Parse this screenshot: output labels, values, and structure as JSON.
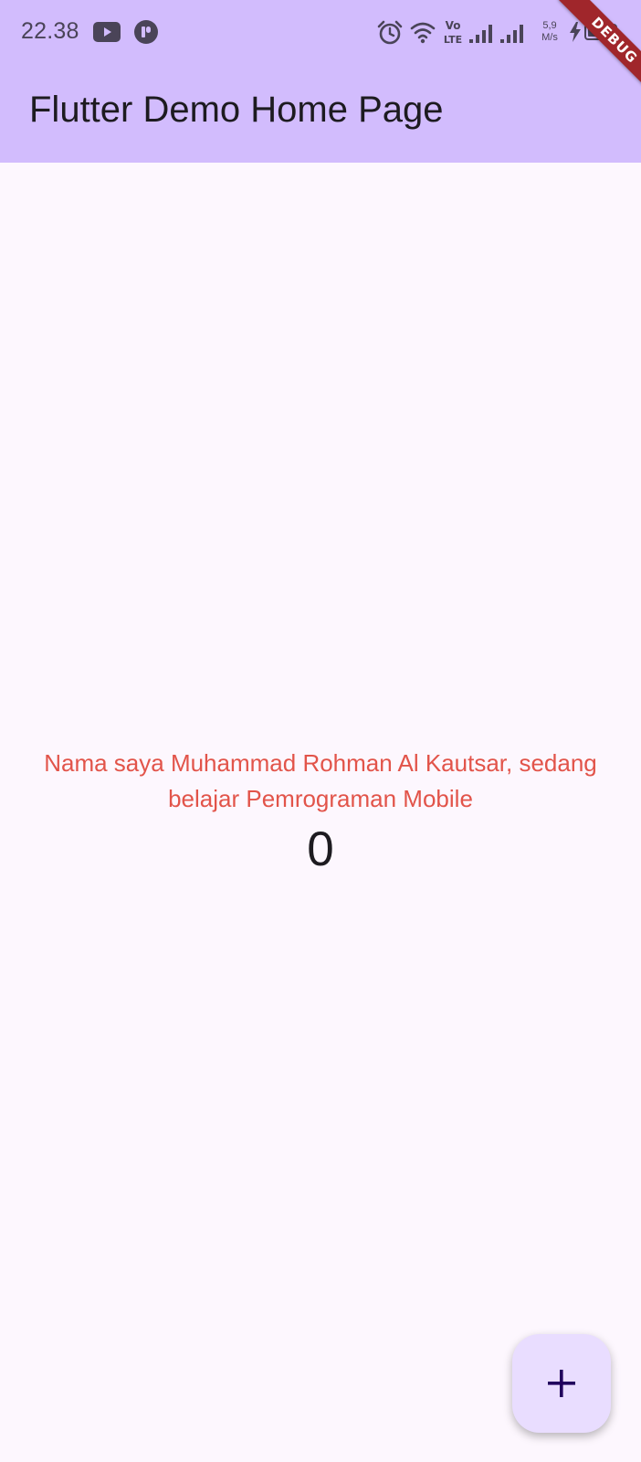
{
  "status_bar": {
    "time": "22.38",
    "net_speed_value": "5,9",
    "net_speed_unit": "M/s",
    "battery_level": "57",
    "icons": [
      "youtube-icon",
      "notification-app-icon",
      "alarm-icon",
      "wifi-icon",
      "volte-icon",
      "signal-icon",
      "signal-icon",
      "charging-icon",
      "battery-icon"
    ]
  },
  "app_bar": {
    "title": "Flutter Demo Home Page"
  },
  "debug_banner": {
    "label": "DEBUG"
  },
  "body": {
    "message": "Nama saya Muhammad Rohman Al Kautsar, sedang belajar Pemrograman Mobile",
    "counter": "0"
  },
  "fab": {
    "icon": "plus-icon"
  },
  "colors": {
    "app_bar": "#d2bcfd",
    "background": "#fdf7fe",
    "message_text": "#e2544a",
    "fab": "#e9ddff",
    "debug_banner": "#a0262b"
  }
}
